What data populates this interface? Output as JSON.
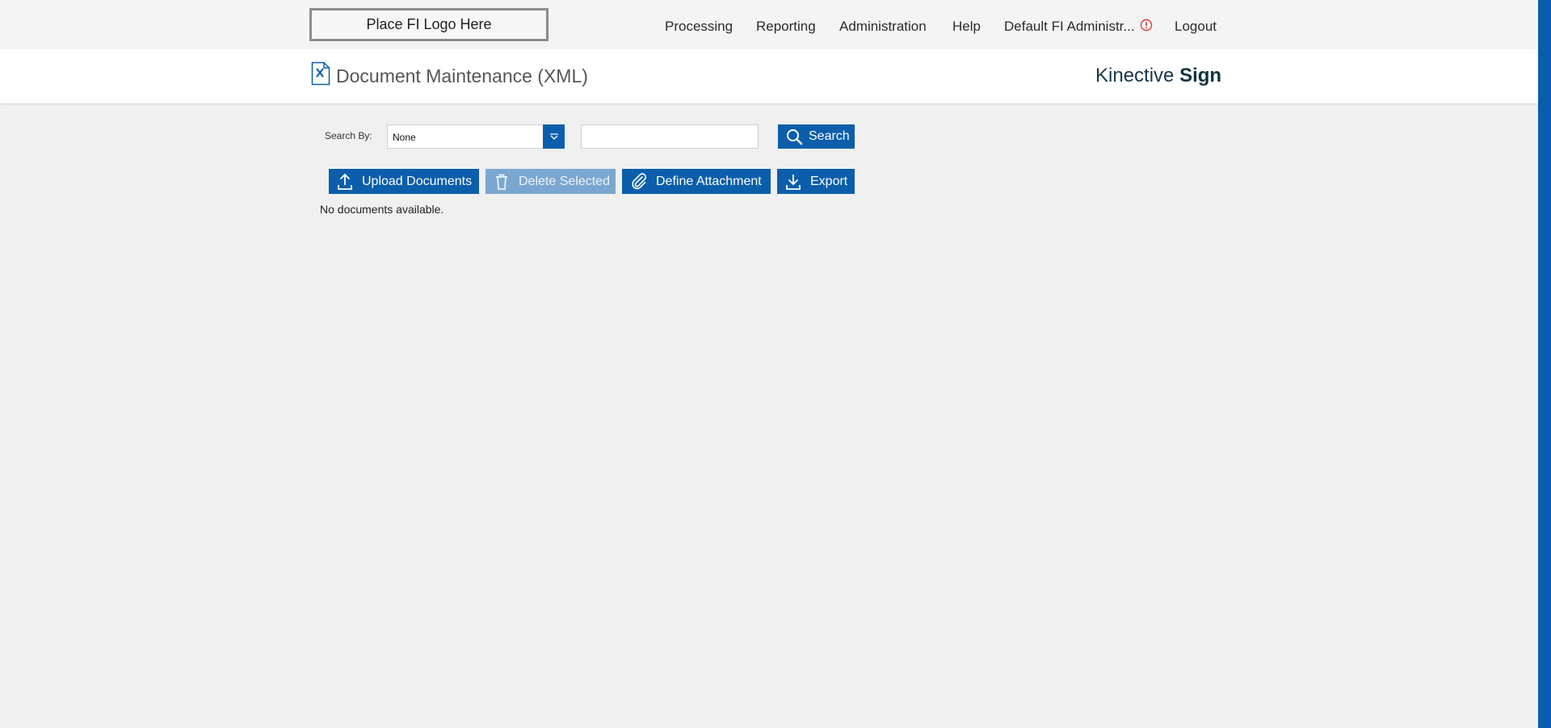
{
  "logo": {
    "text": "Place FI Logo Here"
  },
  "nav": {
    "items": [
      "Processing",
      "Reporting",
      "Administration",
      "Help"
    ],
    "user": "Default FI Administr...",
    "logout": "Logout"
  },
  "header": {
    "title": "Document Maintenance (XML)",
    "brand_light": "Kinective ",
    "brand_bold": "Sign"
  },
  "search": {
    "label": "Search By:",
    "selected": "None",
    "input_value": "",
    "button": "Search"
  },
  "toolbar": {
    "upload": "Upload Documents",
    "delete": "Delete Selected",
    "define": "Define Attachment",
    "export": "Export"
  },
  "content": {
    "empty_message": "No documents available."
  },
  "colors": {
    "primary": "#0b5eab",
    "disabled": "#7aa7d1",
    "alert": "#e53935",
    "background": "#f0f0f0"
  }
}
